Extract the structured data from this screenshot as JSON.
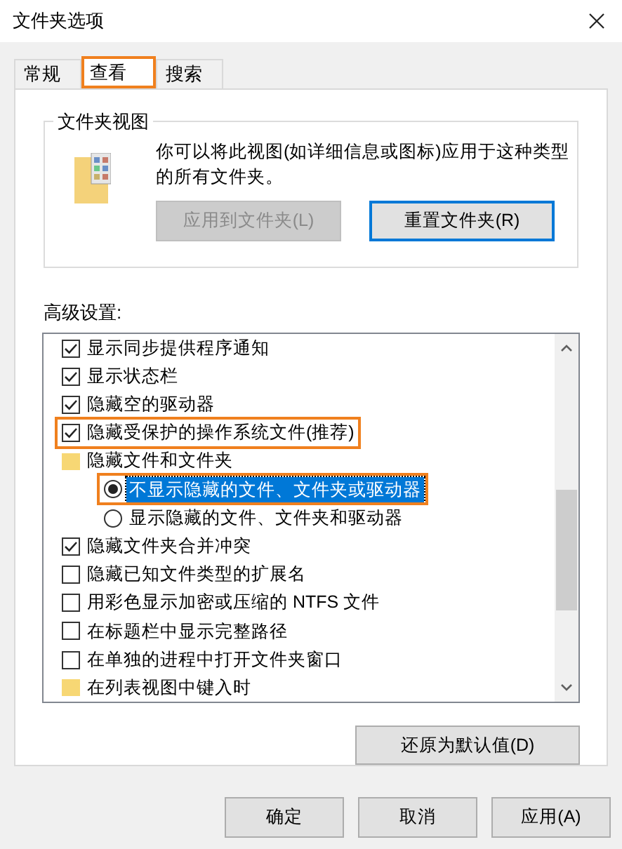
{
  "window": {
    "title": "文件夹选项"
  },
  "tabs": [
    {
      "label": "常规",
      "selected": false,
      "highlighted": false
    },
    {
      "label": "查看",
      "selected": true,
      "highlighted": true
    },
    {
      "label": "搜索",
      "selected": false,
      "highlighted": false
    }
  ],
  "folder_views": {
    "title": "文件夹视图",
    "description": "你可以将此视图(如详细信息或图标)应用于这种类型的所有文件夹。",
    "buttons": [
      {
        "label": "应用到文件夹(L)",
        "disabled": true,
        "focused": false
      },
      {
        "label": "重置文件夹(R)",
        "disabled": false,
        "focused": true
      }
    ]
  },
  "advanced": {
    "title": "高级设置:",
    "items": [
      {
        "kind": "checkbox",
        "label": "显示同步提供程序通知",
        "checked": true,
        "highlighted": false
      },
      {
        "kind": "checkbox",
        "label": "显示状态栏",
        "checked": true,
        "highlighted": false
      },
      {
        "kind": "checkbox",
        "label": "隐藏空的驱动器",
        "checked": true,
        "highlighted": false
      },
      {
        "kind": "checkbox",
        "label": "隐藏受保护的操作系统文件(推荐)",
        "checked": true,
        "highlighted": true
      },
      {
        "kind": "folder",
        "label": "隐藏文件和文件夹",
        "children": [
          {
            "kind": "radio",
            "label": "不显示隐藏的文件、文件夹或驱动器",
            "checked": true,
            "selected": true,
            "highlighted": true
          },
          {
            "kind": "radio",
            "label": "显示隐藏的文件、文件夹和驱动器",
            "checked": false,
            "selected": false,
            "highlighted": false
          }
        ]
      },
      {
        "kind": "checkbox",
        "label": "隐藏文件夹合并冲突",
        "checked": true,
        "highlighted": false
      },
      {
        "kind": "checkbox",
        "label": "隐藏已知文件类型的扩展名",
        "checked": false,
        "highlighted": false
      },
      {
        "kind": "checkbox",
        "label": "用彩色显示加密或压缩的 NTFS 文件",
        "checked": false,
        "highlighted": false
      },
      {
        "kind": "checkbox",
        "label": "在标题栏中显示完整路径",
        "checked": false,
        "highlighted": false
      },
      {
        "kind": "checkbox",
        "label": "在单独的进程中打开文件夹窗口",
        "checked": false,
        "highlighted": false
      },
      {
        "kind": "folder",
        "label": "在列表视图中键入时"
      }
    ],
    "restore_button": "还原为默认值(D)"
  },
  "buttons": [
    "确定",
    "取消",
    "应用(A)"
  ]
}
